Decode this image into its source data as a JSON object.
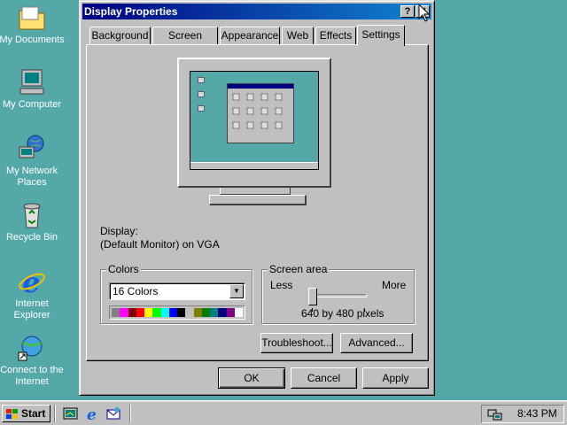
{
  "desktop": {
    "icons": [
      {
        "label": "My Documents"
      },
      {
        "label": "My Computer"
      },
      {
        "label": "My Network Places"
      },
      {
        "label": "Recycle Bin"
      },
      {
        "label": "Internet Explorer"
      },
      {
        "label": "Connect to the Internet"
      }
    ]
  },
  "window": {
    "title": "Display Properties",
    "help_button": "?",
    "close_button": "✕",
    "tabs": [
      {
        "label": "Background"
      },
      {
        "label": "Screen Saver"
      },
      {
        "label": "Appearance"
      },
      {
        "label": "Web"
      },
      {
        "label": "Effects"
      },
      {
        "label": "Settings"
      }
    ],
    "active_tab": "Settings",
    "settings": {
      "display_label": "Display:",
      "display_value": "(Default Monitor) on VGA",
      "colors": {
        "group_title": "Colors",
        "selected": "16 Colors",
        "palette": [
          "#808080",
          "#ff00ff",
          "#800000",
          "#ff0000",
          "#ffff00",
          "#00ff00",
          "#00ffff",
          "#0000ff",
          "#000000",
          "#c0c0c0",
          "#808000",
          "#008000",
          "#008080",
          "#000080",
          "#800080",
          "#ffffff"
        ]
      },
      "screen_area": {
        "group_title": "Screen area",
        "less_label": "Less",
        "more_label": "More",
        "value_text": "640 by 480 pixels",
        "slider_level": 0
      },
      "troubleshoot_button": "Troubleshoot...",
      "advanced_button": "Advanced..."
    },
    "ok_button": "OK",
    "cancel_button": "Cancel",
    "apply_button": "Apply"
  },
  "taskbar": {
    "start_label": "Start",
    "clock": "8:43 PM"
  }
}
